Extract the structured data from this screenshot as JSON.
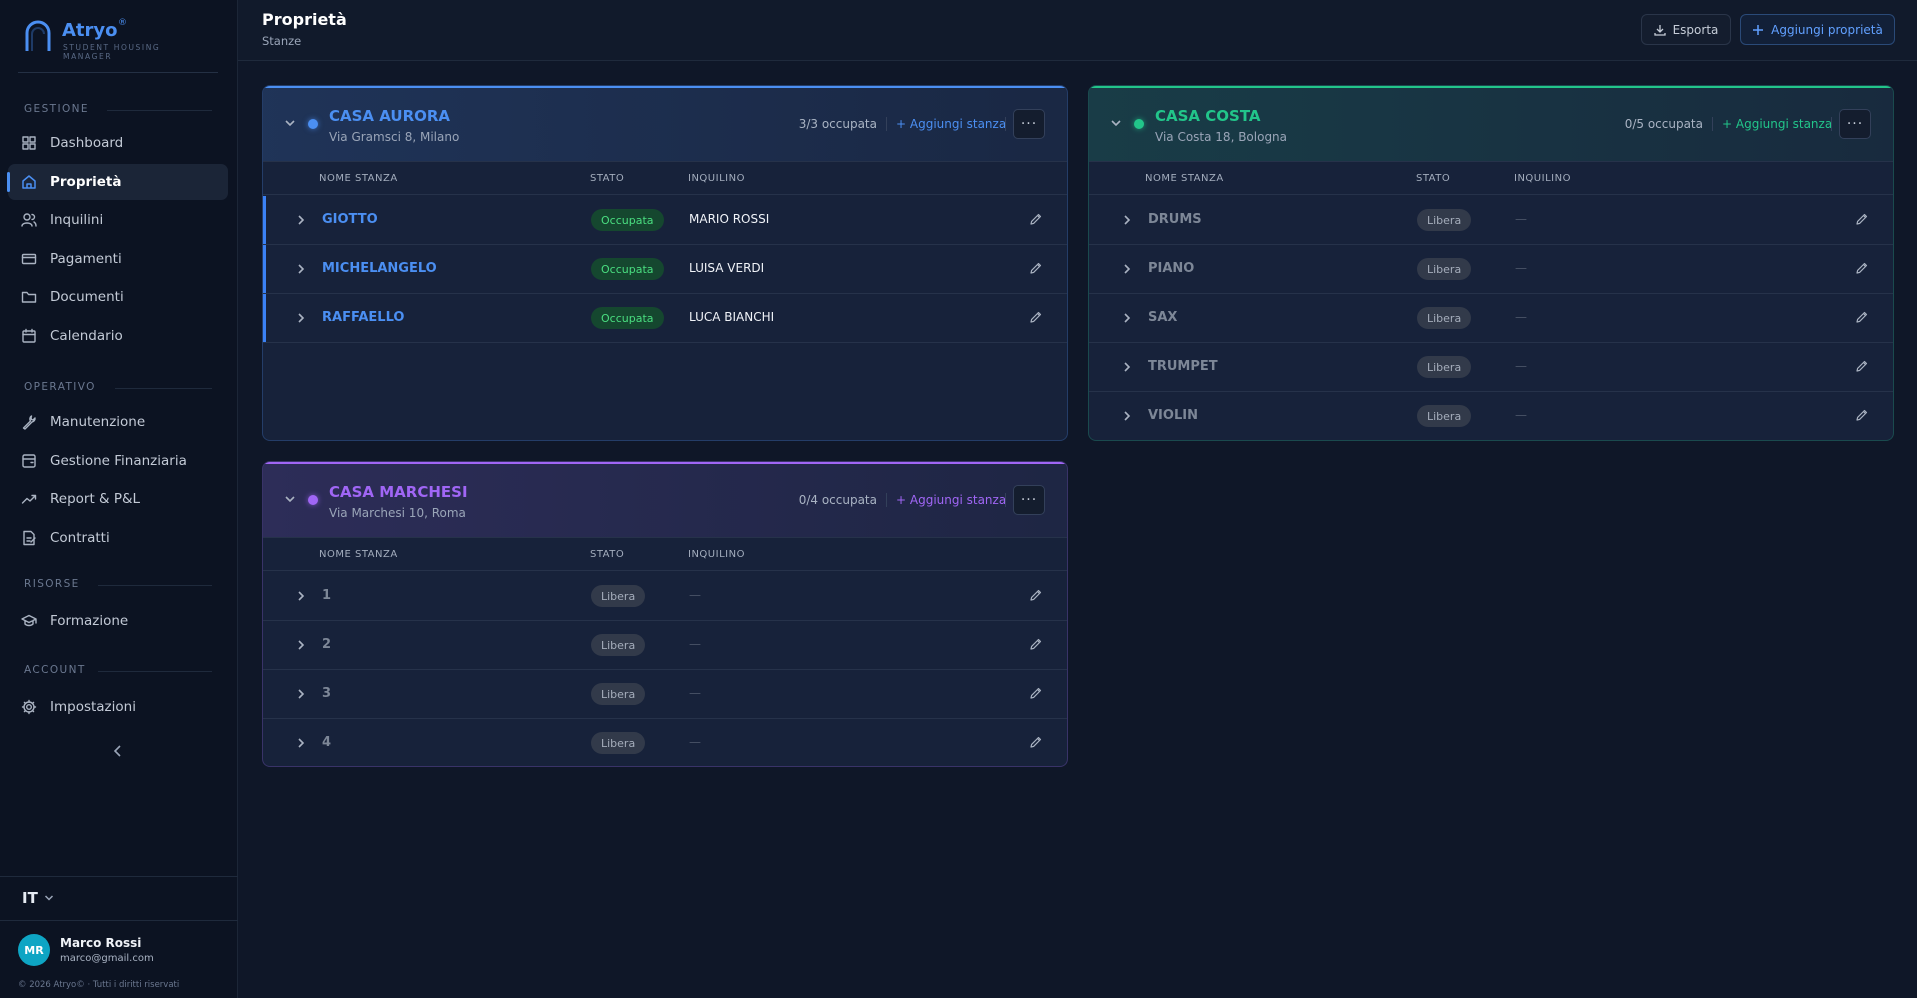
{
  "brand": {
    "name": "Atryo",
    "reg": "®",
    "tagline": "STUDENT HOUSING MANAGER",
    "accent": "#4b8ff2"
  },
  "sidebar": {
    "sections": [
      {
        "label": "GESTIONE",
        "items": [
          {
            "label": "Dashboard",
            "icon": "dashboard-icon"
          },
          {
            "label": "Proprietà",
            "icon": "building-icon",
            "active": true
          },
          {
            "label": "Inquilini",
            "icon": "users-icon"
          },
          {
            "label": "Pagamenti",
            "icon": "wallet-icon"
          },
          {
            "label": "Documenti",
            "icon": "folder-icon"
          },
          {
            "label": "Calendario",
            "icon": "calendar-icon"
          }
        ]
      },
      {
        "label": "OPERATIVO",
        "items": [
          {
            "label": "Manutenzione",
            "icon": "wrench-icon"
          },
          {
            "label": "Gestione Finanziaria",
            "icon": "finance-icon"
          },
          {
            "label": "Report & P&L",
            "icon": "trend-icon"
          },
          {
            "label": "Contratti",
            "icon": "contract-icon"
          }
        ]
      },
      {
        "label": "RISORSE",
        "items": [
          {
            "label": "Formazione",
            "icon": "graduation-cap-icon"
          }
        ]
      },
      {
        "label": "ACCOUNT",
        "items": [
          {
            "label": "Impostazioni",
            "icon": "gear-icon"
          }
        ]
      }
    ],
    "language": "IT",
    "user": {
      "initials": "MR",
      "name": "Marco Rossi",
      "email": "marco@gmail.com"
    },
    "copyright": "© 2026 Atryo© · Tutti i diritti riservati"
  },
  "header": {
    "title": "Proprietà",
    "subtitle": "Stanze",
    "export_label": "Esporta",
    "add_property_label": "Aggiungi proprietà"
  },
  "table_headers": {
    "name": "NOME STANZA",
    "status": "STATO",
    "tenant": "INQUILINO"
  },
  "properties": [
    {
      "name": "CASA AURORA",
      "address": "Via Gramsci 8, Milano",
      "occupancy": "3/3 occupata",
      "add_room_label": "+ Aggiungi stanza",
      "color": "#4b8ff2",
      "rooms": [
        {
          "name": "GIOTTO",
          "status": "Occupata",
          "tenant": "MARIO ROSSI"
        },
        {
          "name": "MICHELANGELO",
          "status": "Occupata",
          "tenant": "LUISA VERDI"
        },
        {
          "name": "RAFFAELLO",
          "status": "Occupata",
          "tenant": "LUCA BIANCHI"
        }
      ]
    },
    {
      "name": "CASA COSTA",
      "address": "Via Costa 18, Bologna",
      "occupancy": "0/5 occupata",
      "add_room_label": "+ Aggiungi stanza",
      "color": "#22c58a",
      "rooms": [
        {
          "name": "DRUMS",
          "status": "Libera",
          "tenant": "—"
        },
        {
          "name": "PIANO",
          "status": "Libera",
          "tenant": "—"
        },
        {
          "name": "SAX",
          "status": "Libera",
          "tenant": "—"
        },
        {
          "name": "TRUMPET",
          "status": "Libera",
          "tenant": "—"
        },
        {
          "name": "VIOLIN",
          "status": "Libera",
          "tenant": "—"
        }
      ]
    },
    {
      "name": "CASA MARCHESI",
      "address": "Via Marchesi 10, Roma",
      "occupancy": "0/4 occupata",
      "add_room_label": "+ Aggiungi stanza",
      "color": "#a066f5",
      "rooms": [
        {
          "name": "1",
          "status": "Libera",
          "tenant": "—"
        },
        {
          "name": "2",
          "status": "Libera",
          "tenant": "—"
        },
        {
          "name": "3",
          "status": "Libera",
          "tenant": "—"
        },
        {
          "name": "4",
          "status": "Libera",
          "tenant": "—"
        }
      ]
    }
  ]
}
